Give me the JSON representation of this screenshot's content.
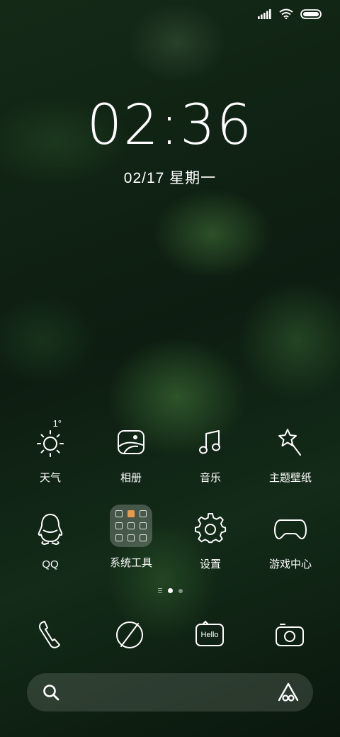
{
  "status_bar": {
    "icons": [
      "signal-icon",
      "wifi-icon",
      "battery-icon"
    ]
  },
  "lockscreen": {
    "time": "02:36",
    "date": "02/17 星期一"
  },
  "apps_row1": [
    {
      "label": "天气",
      "icon": "weather-sun-icon",
      "badge": "1°"
    },
    {
      "label": "相册",
      "icon": "gallery-icon"
    },
    {
      "label": "音乐",
      "icon": "music-note-icon"
    },
    {
      "label": "主题壁纸",
      "icon": "theme-wand-icon"
    }
  ],
  "apps_row2": [
    {
      "label": "QQ",
      "icon": "qq-penguin-icon"
    },
    {
      "label": "系统工具",
      "icon": "folder-icon"
    },
    {
      "label": "设置",
      "icon": "gear-icon"
    },
    {
      "label": "游戏中心",
      "icon": "gamepad-icon"
    }
  ],
  "page_indicator": {
    "pages": 3,
    "active": 1
  },
  "dock": [
    {
      "icon": "phone-icon"
    },
    {
      "icon": "browser-compass-icon"
    },
    {
      "icon": "messages-icon",
      "text": "Hello"
    },
    {
      "icon": "camera-icon"
    }
  ],
  "search_bar": {
    "left_icon": "search-icon",
    "right_icon": "assistant-icon"
  }
}
